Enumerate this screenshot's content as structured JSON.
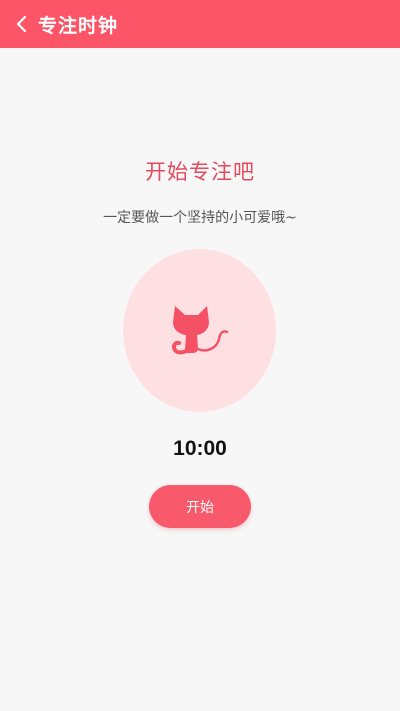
{
  "header": {
    "title": "专注时钟",
    "back_icon": "chevron-left-icon"
  },
  "main": {
    "headline": "开始专注吧",
    "subline": "一定要做一个坚持的小可爱哦~",
    "illustration_icon": "cat-icon",
    "timer": "10:00",
    "start_label": "开始"
  },
  "colors": {
    "accent": "#fc5568",
    "circle_bg": "#fee0e3",
    "headline": "#e34a5d"
  }
}
